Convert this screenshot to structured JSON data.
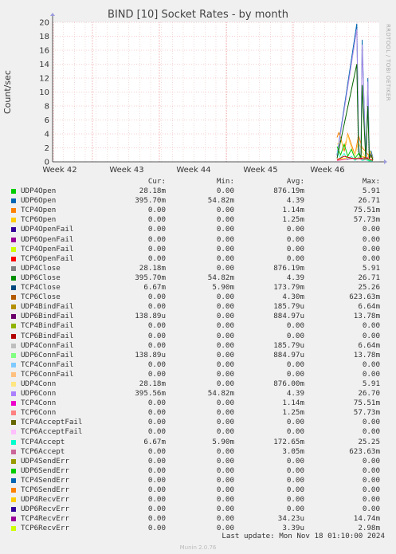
{
  "title": "BIND [10] Socket Rates - by month",
  "side_text": "RRDTOOL / TOBI OETIKER",
  "colors": {
    "grid_major": "#f0a0a0",
    "grid_minor": "#e8b8b8",
    "plot_bg": "#ffffff",
    "axis": "#555555"
  },
  "chart_data": {
    "type": "line",
    "title": "BIND [10] Socket Rates - by month",
    "ylabel": "Count/sec",
    "xlabel": "",
    "ylim": [
      0,
      20
    ],
    "y_ticks": [
      0,
      2,
      4,
      6,
      8,
      10,
      12,
      14,
      16,
      18,
      20
    ],
    "x_tick_labels": [
      "Week 42",
      "Week 43",
      "Week 44",
      "Week 45",
      "Week 46"
    ],
    "grid": true,
    "series": [
      {
        "name": "UDP6Open",
        "color": "#0066B3",
        "t": [
          0,
          0.55,
          0.6,
          0.63,
          0.67,
          0.7,
          0.78,
          0.82,
          0.86,
          0.9,
          0.95,
          1
        ],
        "v": [
          1.0,
          19.8,
          3.0,
          0.5,
          1.0,
          17.5,
          4.0,
          0.8,
          12.0,
          0.8,
          1.5,
          0.6
        ]
      },
      {
        "name": "TCP4Open",
        "color": "#FF8000",
        "t": [
          0,
          0.05,
          0.1,
          0.2,
          0.3,
          0.4,
          0.5,
          0.6,
          0.7,
          0.8,
          0.9,
          1
        ],
        "v": [
          3.5,
          4.2,
          3.5,
          1.5,
          4.0,
          2.5,
          1.0,
          3.8,
          2.0,
          1.5,
          0.8,
          0.5
        ]
      },
      {
        "name": "UDP4Conn",
        "color": "#FFD966",
        "t": [
          0,
          0.1,
          0.2,
          0.3,
          0.4,
          0.5,
          0.6,
          0.7,
          0.8,
          0.9,
          1
        ],
        "v": [
          2.5,
          3.0,
          2.2,
          3.8,
          2.0,
          1.0,
          2.8,
          1.5,
          0.6,
          0.4,
          0.3
        ]
      },
      {
        "name": "UDP6Conn",
        "color": "#AF8FE8",
        "t": [
          0,
          0.55,
          0.6,
          0.63,
          0.67,
          0.7,
          0.78,
          0.82,
          0.86,
          0.9,
          0.95,
          1
        ],
        "v": [
          0.8,
          19.0,
          2.5,
          0.4,
          0.9,
          16.8,
          3.6,
          0.6,
          11.5,
          0.6,
          1.2,
          0.5
        ]
      },
      {
        "name": "TCP6Open",
        "color": "#FFCC00",
        "t": [
          0,
          0.3,
          0.5,
          0.7,
          0.85,
          0.92,
          0.96,
          1
        ],
        "v": [
          0.3,
          0.6,
          0.4,
          0.8,
          0.5,
          1.5,
          1.0,
          0.4
        ]
      },
      {
        "name": "UDP4Open",
        "color": "#00CC00",
        "t": [
          0,
          0.1,
          0.2,
          0.3,
          0.4,
          0.5,
          0.6,
          0.7,
          0.8,
          0.9,
          1
        ],
        "v": [
          2.2,
          1.0,
          2.5,
          0.8,
          1.8,
          0.5,
          1.2,
          0.3,
          0.5,
          0.2,
          0.1
        ]
      },
      {
        "name": "TCP4Accept",
        "color": "#33FFCC",
        "t": [
          0,
          0.1,
          0.2,
          0.3,
          0.4,
          0.5,
          0.6,
          0.7,
          0.8,
          0.9,
          1
        ],
        "v": [
          1.5,
          0.5,
          1.2,
          0.3,
          0.8,
          0.2,
          0.6,
          0.2,
          0.3,
          0.1,
          0.1
        ]
      },
      {
        "name": "TCP4Conn",
        "color": "#FF3399",
        "t": [
          0,
          0.5,
          0.8,
          0.95,
          1
        ],
        "v": [
          0.2,
          0.5,
          0.3,
          1.0,
          0.3
        ]
      },
      {
        "name": "UDP6Close",
        "color": "#006400",
        "t": [
          0,
          0.55,
          0.6,
          0.67,
          0.7,
          0.8,
          0.86,
          0.9,
          0.95,
          1
        ],
        "v": [
          0.5,
          14.0,
          1.5,
          0.6,
          11.0,
          0.5,
          8.0,
          0.5,
          1.0,
          0.3
        ]
      },
      {
        "name": "UDP4Close",
        "color": "#CC0000",
        "t": [
          0,
          0.2,
          0.5,
          0.8,
          1
        ],
        "v": [
          0.3,
          0.8,
          0.4,
          0.6,
          0.2
        ]
      }
    ],
    "legend": {
      "headers": [
        "Cur:",
        "Min:",
        "Avg:",
        "Max:"
      ],
      "rows": [
        {
          "name": "UDP4Open",
          "color": "#00CC00",
          "cur": "28.18m",
          "min": "0.00",
          "avg": "876.19m",
          "max": "5.91"
        },
        {
          "name": "UDP6Open",
          "color": "#0066B3",
          "cur": "395.70m",
          "min": "54.82m",
          "avg": "4.39",
          "max": "26.71"
        },
        {
          "name": "TCP4Open",
          "color": "#FF8000",
          "cur": "0.00",
          "min": "0.00",
          "avg": "1.14m",
          "max": "75.51m"
        },
        {
          "name": "TCP6Open",
          "color": "#FFCC00",
          "cur": "0.00",
          "min": "0.00",
          "avg": "1.25m",
          "max": "57.73m"
        },
        {
          "name": "UDP4OpenFail",
          "color": "#330099",
          "cur": "0.00",
          "min": "0.00",
          "avg": "0.00",
          "max": "0.00"
        },
        {
          "name": "UDP6OpenFail",
          "color": "#990099",
          "cur": "0.00",
          "min": "0.00",
          "avg": "0.00",
          "max": "0.00"
        },
        {
          "name": "TCP4OpenFail",
          "color": "#CCFF00",
          "cur": "0.00",
          "min": "0.00",
          "avg": "0.00",
          "max": "0.00"
        },
        {
          "name": "TCP6OpenFail",
          "color": "#FF0000",
          "cur": "0.00",
          "min": "0.00",
          "avg": "0.00",
          "max": "0.00"
        },
        {
          "name": "UDP4Close",
          "color": "#808080",
          "cur": "28.18m",
          "min": "0.00",
          "avg": "876.19m",
          "max": "5.91"
        },
        {
          "name": "UDP6Close",
          "color": "#008F00",
          "cur": "395.70m",
          "min": "54.82m",
          "avg": "4.39",
          "max": "26.71"
        },
        {
          "name": "TCP4Close",
          "color": "#00487D",
          "cur": "6.67m",
          "min": "5.90m",
          "avg": "173.79m",
          "max": "25.26"
        },
        {
          "name": "TCP6Close",
          "color": "#B35A00",
          "cur": "0.00",
          "min": "0.00",
          "avg": "4.30m",
          "max": "623.63m"
        },
        {
          "name": "UDP4BindFail",
          "color": "#B38F00",
          "cur": "0.00",
          "min": "0.00",
          "avg": "185.79u",
          "max": "6.64m"
        },
        {
          "name": "UDP6BindFail",
          "color": "#6B006B",
          "cur": "138.89u",
          "min": "0.00",
          "avg": "884.97u",
          "max": "13.78m"
        },
        {
          "name": "TCP4BindFail",
          "color": "#8FB300",
          "cur": "0.00",
          "min": "0.00",
          "avg": "0.00",
          "max": "0.00"
        },
        {
          "name": "TCP6BindFail",
          "color": "#B30000",
          "cur": "0.00",
          "min": "0.00",
          "avg": "0.00",
          "max": "0.00"
        },
        {
          "name": "UDP4ConnFail",
          "color": "#BEBEBE",
          "cur": "0.00",
          "min": "0.00",
          "avg": "185.79u",
          "max": "6.64m"
        },
        {
          "name": "UDP6ConnFail",
          "color": "#80FF80",
          "cur": "138.89u",
          "min": "0.00",
          "avg": "884.97u",
          "max": "13.78m"
        },
        {
          "name": "TCP4ConnFail",
          "color": "#80C9FF",
          "cur": "0.00",
          "min": "0.00",
          "avg": "0.00",
          "max": "0.00"
        },
        {
          "name": "TCP6ConnFail",
          "color": "#FFC080",
          "cur": "0.00",
          "min": "0.00",
          "avg": "0.00",
          "max": "0.00"
        },
        {
          "name": "UDP4Conn",
          "color": "#FFE680",
          "cur": "28.18m",
          "min": "0.00",
          "avg": "876.00m",
          "max": "5.91"
        },
        {
          "name": "UDP6Conn",
          "color": "#AA80FF",
          "cur": "395.56m",
          "min": "54.82m",
          "avg": "4.39",
          "max": "26.70"
        },
        {
          "name": "TCP4Conn",
          "color": "#EE00CC",
          "cur": "0.00",
          "min": "0.00",
          "avg": "1.14m",
          "max": "75.51m"
        },
        {
          "name": "TCP6Conn",
          "color": "#FF8080",
          "cur": "0.00",
          "min": "0.00",
          "avg": "1.25m",
          "max": "57.73m"
        },
        {
          "name": "TCP4AcceptFail",
          "color": "#666600",
          "cur": "0.00",
          "min": "0.00",
          "avg": "0.00",
          "max": "0.00"
        },
        {
          "name": "TCP6AcceptFail",
          "color": "#FFBFFF",
          "cur": "0.00",
          "min": "0.00",
          "avg": "0.00",
          "max": "0.00"
        },
        {
          "name": "TCP4Accept",
          "color": "#00FFCC",
          "cur": "6.67m",
          "min": "5.90m",
          "avg": "172.65m",
          "max": "25.25"
        },
        {
          "name": "TCP6Accept",
          "color": "#CC6699",
          "cur": "0.00",
          "min": "0.00",
          "avg": "3.05m",
          "max": "623.63m"
        },
        {
          "name": "UDP4SendErr",
          "color": "#999900",
          "cur": "0.00",
          "min": "0.00",
          "avg": "0.00",
          "max": "0.00"
        },
        {
          "name": "UDP6SendErr",
          "color": "#00CC00",
          "cur": "0.00",
          "min": "0.00",
          "avg": "0.00",
          "max": "0.00"
        },
        {
          "name": "TCP4SendErr",
          "color": "#0066B3",
          "cur": "0.00",
          "min": "0.00",
          "avg": "0.00",
          "max": "0.00"
        },
        {
          "name": "TCP6SendErr",
          "color": "#FF8000",
          "cur": "0.00",
          "min": "0.00",
          "avg": "0.00",
          "max": "0.00"
        },
        {
          "name": "UDP4RecvErr",
          "color": "#FFCC00",
          "cur": "0.00",
          "min": "0.00",
          "avg": "0.00",
          "max": "0.00"
        },
        {
          "name": "UDP6RecvErr",
          "color": "#330099",
          "cur": "0.00",
          "min": "0.00",
          "avg": "0.00",
          "max": "0.00"
        },
        {
          "name": "TCP4RecvErr",
          "color": "#990099",
          "cur": "0.00",
          "min": "0.00",
          "avg": "34.23u",
          "max": "14.74m"
        },
        {
          "name": "TCP6RecvErr",
          "color": "#CCFF00",
          "cur": "0.00",
          "min": "0.00",
          "avg": "3.39u",
          "max": "2.98m"
        }
      ]
    }
  },
  "footer": {
    "last_update": "Last update: Mon Nov 18 01:10:00 2024",
    "munin": "Munin 2.0.76"
  }
}
